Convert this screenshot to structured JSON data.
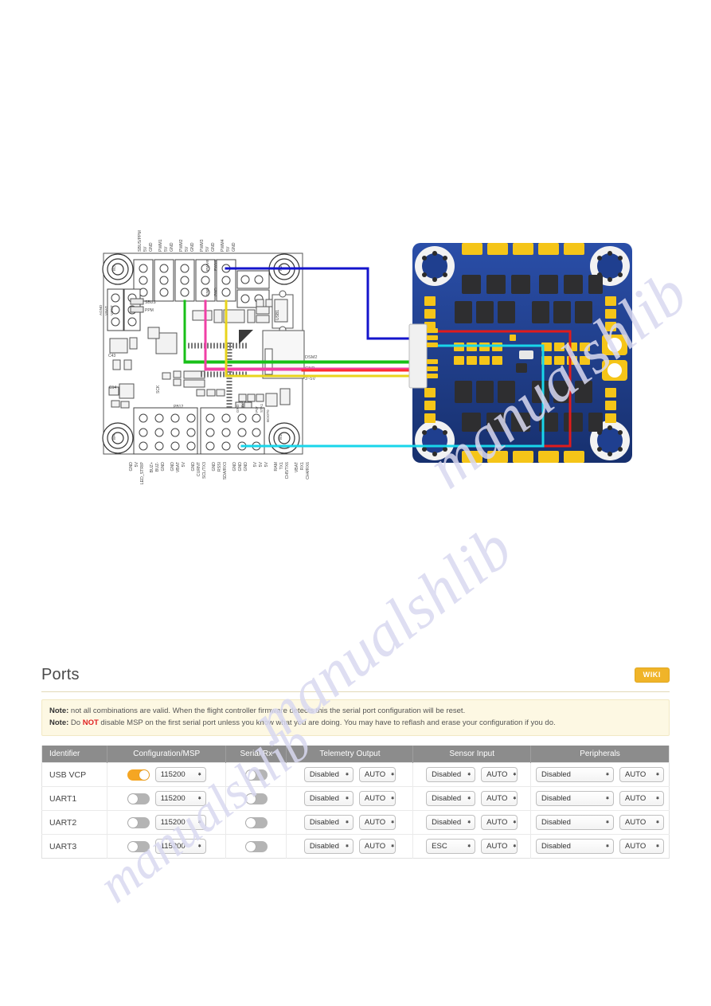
{
  "watermark": {
    "text": "manualshlib"
  },
  "diagram": {
    "name": "flight-controller-to-4in1-esc-wiring-diagram",
    "fc_top_pin_labels": [
      {
        "signal": "SBUS/PPM",
        "v": "5V",
        "g": "GND"
      },
      {
        "signal": "PWM1",
        "v": "5V",
        "g": "GND"
      },
      {
        "signal": "PWM2",
        "v": "5V",
        "g": "GND"
      },
      {
        "signal": "PWM3",
        "v": "5V",
        "g": "GND"
      },
      {
        "signal": "PWM4",
        "v": "5V",
        "g": "GND"
      }
    ],
    "fc_bottom_pin_labels": [
      {
        "a": "GND",
        "b": "5V",
        "c": "LED_STRIP"
      },
      {
        "a": "BUZ+",
        "b": "BUZ-",
        "c": "GND"
      },
      {
        "a": "GND",
        "b": "VBAT",
        "c": "5V"
      },
      {
        "a": "GND",
        "b": "CURNT",
        "c": "SCL/TX3"
      },
      {
        "a": "GND",
        "b": "RSSI",
        "c": "SDA/RX3"
      },
      {
        "a": "GND",
        "b": "GND",
        "c": "GND"
      },
      {
        "a": "5V",
        "b": "5V",
        "c": "5V"
      },
      {
        "a": "RAM",
        "b": "TX1",
        "c": "CH5/TX6"
      },
      {
        "a": "VBAT",
        "b": "RX1",
        "c": "CH4/RX6"
      }
    ],
    "center_labels": [
      "DSM2",
      "GND",
      "3~5V"
    ],
    "extra_labels": [
      "SBUS",
      "PPM",
      "PWM5",
      "PWM6",
      "GND",
      "GND",
      "USB1",
      "PB12",
      "PB13",
      "SCK"
    ],
    "motor_mounts": [
      "M3",
      "M2",
      "M4",
      "M1"
    ],
    "wire_colors": [
      "#e01b1b",
      "#1414cc",
      "#19d6ea",
      "#18c018",
      "#f03fa6",
      "#ff2d2d",
      "#e8d41c"
    ],
    "esc_board_color": "#1f3f8f",
    "esc_pad_color": "#f5c518"
  },
  "panel": {
    "title": "Ports",
    "wiki_label": "WIKI",
    "notes": [
      {
        "prefix": "Note:",
        "text": " not all combinations are valid. When the flight controller firmware detects this the serial port configuration will be reset."
      },
      {
        "prefix": "Note:",
        "pre": " Do ",
        "warn": "NOT",
        "post": " disable MSP on the first serial port unless you know what you are doing. You may have to reflash and erase your configuration if you do."
      }
    ]
  },
  "table": {
    "headers": [
      "Identifier",
      "Configuration/MSP",
      "Serial Rx",
      "Telemetry Output",
      "Sensor Input",
      "Peripherals"
    ],
    "rows": [
      {
        "identifier": "USB VCP",
        "msp_toggle": "on",
        "baud": "115200",
        "serial_rx_toggle": "off",
        "telemetry_mode": "Disabled",
        "telemetry_baud": "AUTO",
        "sensor_mode": "Disabled",
        "sensor_baud": "AUTO",
        "peripheral_mode": "Disabled",
        "peripheral_baud": "AUTO"
      },
      {
        "identifier": "UART1",
        "msp_toggle": "off",
        "baud": "115200",
        "serial_rx_toggle": "off",
        "telemetry_mode": "Disabled",
        "telemetry_baud": "AUTO",
        "sensor_mode": "Disabled",
        "sensor_baud": "AUTO",
        "peripheral_mode": "Disabled",
        "peripheral_baud": "AUTO"
      },
      {
        "identifier": "UART2",
        "msp_toggle": "off",
        "baud": "115200",
        "serial_rx_toggle": "off",
        "telemetry_mode": "Disabled",
        "telemetry_baud": "AUTO",
        "sensor_mode": "Disabled",
        "sensor_baud": "AUTO",
        "peripheral_mode": "Disabled",
        "peripheral_baud": "AUTO"
      },
      {
        "identifier": "UART3",
        "msp_toggle": "off",
        "baud": "115200",
        "serial_rx_toggle": "off",
        "telemetry_mode": "Disabled",
        "telemetry_baud": "AUTO",
        "sensor_mode": "ESC",
        "sensor_baud": "AUTO",
        "peripheral_mode": "Disabled",
        "peripheral_baud": "AUTO"
      }
    ]
  }
}
